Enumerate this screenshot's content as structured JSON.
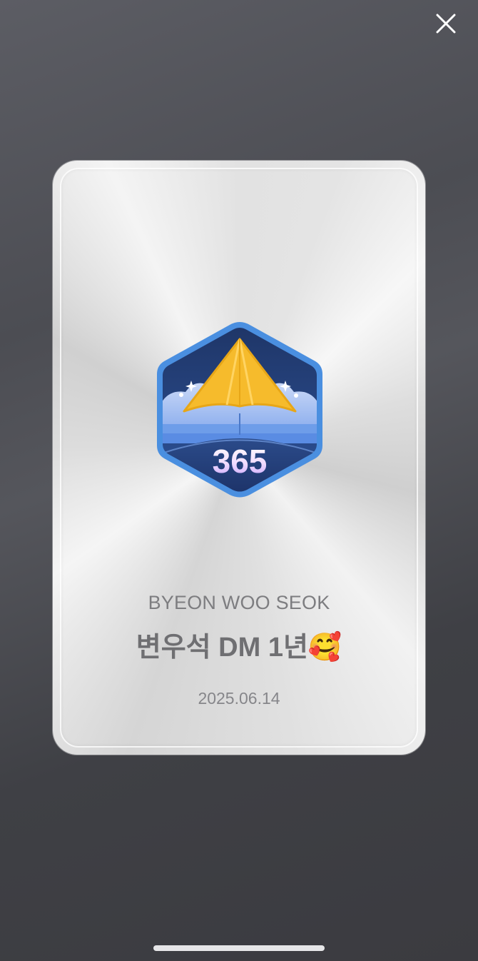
{
  "close_icon": "close-icon",
  "badge": {
    "icon": "paper-plane-badge-icon",
    "number": "365"
  },
  "card": {
    "name_en": "BYEON WOO SEOK",
    "title": "변우석 DM 1년🥰",
    "date": "2025.06.14"
  },
  "colors": {
    "badge_blue": "#3d7fd6",
    "badge_navy": "#1f3668",
    "plane_yellow": "#f6bb2c"
  }
}
